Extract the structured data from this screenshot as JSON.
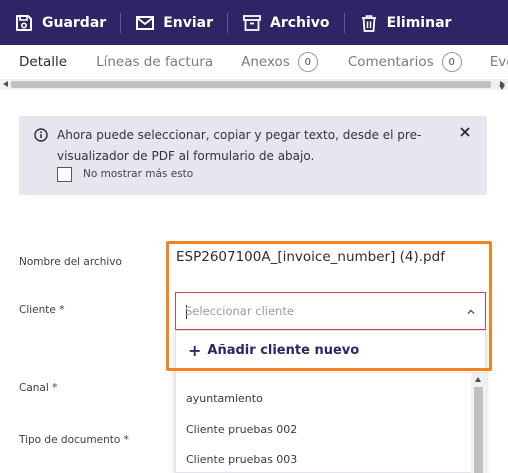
{
  "toolbar": {
    "save_label": "Guardar",
    "send_label": "Enviar",
    "archive_label": "Archivo",
    "delete_label": "Eliminar"
  },
  "tabs": [
    {
      "label": "Detalle",
      "active": true
    },
    {
      "label": "Líneas de factura"
    },
    {
      "label": "Anexos",
      "count": "0"
    },
    {
      "label": "Comentarios",
      "count": "0"
    },
    {
      "label": "Eventos"
    }
  ],
  "banner": {
    "message": "Ahora puede seleccionar, copiar y pegar texto, desde el pre-visualizador de PDF al formulario de abajo.",
    "checkbox_label": "No mostrar más esto"
  },
  "form": {
    "file_label": "Nombre del archivo",
    "file_value": "ESP2607100A_[invoice_number] (4).pdf",
    "client_label": "Cliente *",
    "client_placeholder": "Seleccionar cliente",
    "channel_label": "Canal *",
    "doctype_label": "Tipo de documento *"
  },
  "dropdown": {
    "add_label": "Añadir cliente nuevo",
    "options": [
      "ayuntamiento",
      "Cliente pruebas 002",
      "Cliente pruebas 003"
    ]
  },
  "colors": {
    "toolbar_bg": "#2e2566",
    "highlight": "#f58220",
    "error_border": "#d3424e",
    "banner_bg": "#e6e6ef"
  }
}
